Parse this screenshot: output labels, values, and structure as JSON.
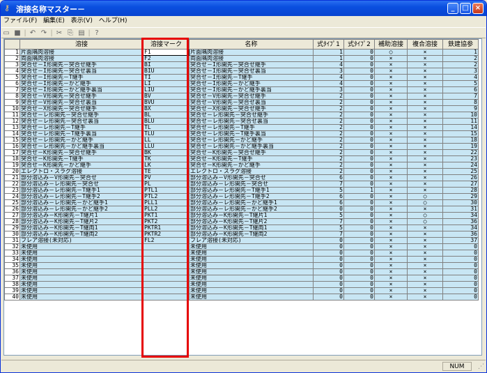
{
  "window": {
    "title": "溶接名称マスター－",
    "app_icon": "key-icon"
  },
  "menu": [
    "ファイル(F)",
    "編集(E)",
    "表示(V)",
    "ヘルプ(H)"
  ],
  "toolbar_icons": [
    "new-icon",
    "save-icon",
    "undo-icon",
    "redo-icon",
    "cut-icon",
    "copy-icon",
    "paste-icon",
    "help-icon"
  ],
  "toolbar_glyphs": [
    "▭",
    "■",
    "↶",
    "↷",
    "✂",
    "⎘",
    "▤",
    "?"
  ],
  "columns": [
    "",
    "溶接",
    "溶接マーク",
    "名称",
    "式ﾀｲﾌﾟ1",
    "式ﾀｲﾌﾟ2",
    "補助溶接",
    "複合溶接",
    "鉄建協参"
  ],
  "rows": [
    [
      "1",
      "片面隅肉溶接",
      "F1",
      "片面隅肉溶接",
      "1",
      "0",
      "○",
      "×",
      "1"
    ],
    [
      "2",
      "両面隅肉溶接",
      "F2",
      "両面隅肉溶接",
      "1",
      "0",
      "×",
      "×",
      "2"
    ],
    [
      "3",
      "突合せ－I形開先－突合せ継手",
      "BI",
      "突合せ－I形開先－突合せ継手",
      "4",
      "0",
      "×",
      "×",
      "2"
    ],
    [
      "4",
      "突合せ－I形開先－突合せ裏当",
      "BIU",
      "突合せ－I形開先－突合せ裏当",
      "3",
      "0",
      "×",
      "×",
      "3"
    ],
    [
      "5",
      "突合せ－I形開先－T継手",
      "TI",
      "突合せ－I形開先－T継手",
      "4",
      "0",
      "×",
      "×",
      "4"
    ],
    [
      "6",
      "突合せ－I形開先－かど継手",
      "LI",
      "突合せ－I形開先－かど継手",
      "4",
      "0",
      "×",
      "×",
      "5"
    ],
    [
      "7",
      "突合せ－I形開先－かど継手裏当",
      "LIU",
      "突合せ－I形開先－かど継手裏当",
      "3",
      "0",
      "×",
      "×",
      "6"
    ],
    [
      "8",
      "突合せ－V形開先－突合せ継手",
      "BV",
      "突合せ－V形開先－突合せ継手",
      "2",
      "0",
      "×",
      "×",
      "7"
    ],
    [
      "9",
      "突合せ－V形開先－突合せ裏当",
      "BVU",
      "突合せ－V形開先－突合せ裏当",
      "2",
      "0",
      "×",
      "×",
      "8"
    ],
    [
      "10",
      "突合せ－X形開先－突合せ継手",
      "BX",
      "突合せ－X形開先－突合せ継手",
      "2",
      "0",
      "×",
      "×",
      "9"
    ],
    [
      "11",
      "突合せ－レ形開先－突合せ継手",
      "BL",
      "突合せ－レ形開先－突合せ継手",
      "2",
      "0",
      "×",
      "×",
      "10"
    ],
    [
      "12",
      "突合せ－レ形開先－突合せ裏当",
      "BLU",
      "突合せ－レ形開先－突合せ裏当",
      "2",
      "0",
      "×",
      "×",
      "11"
    ],
    [
      "13",
      "突合せ－レ形開先－T継手",
      "TL",
      "突合せ－レ形開先－T継手",
      "2",
      "0",
      "×",
      "×",
      "14"
    ],
    [
      "14",
      "突合せ－レ形開先－T継手裏当",
      "TLU",
      "突合せ－レ形開先－T継手裏当",
      "2",
      "0",
      "×",
      "×",
      "15"
    ],
    [
      "15",
      "突合せ－レ形開先－かど継手",
      "LL",
      "突合せ－レ形開先－かど継手",
      "2",
      "0",
      "×",
      "×",
      "18"
    ],
    [
      "16",
      "突合せ－レ形開先－かど継手裏当",
      "LLU",
      "突合せ－レ形開先－かど継手裏当",
      "2",
      "0",
      "×",
      "×",
      "19"
    ],
    [
      "17",
      "突合せ－K形開先－突合せ継手",
      "BK",
      "突合せ－K形開先－突合せ継手",
      "2",
      "0",
      "×",
      "×",
      "22"
    ],
    [
      "18",
      "突合せ－K形開先－T継手",
      "TK",
      "突合せ－K形開先－T継手",
      "2",
      "0",
      "×",
      "×",
      "23"
    ],
    [
      "19",
      "突合せ－K形開先－かど継手",
      "LK",
      "突合せ－K形開先－かど継手",
      "2",
      "0",
      "×",
      "×",
      "24"
    ],
    [
      "20",
      "エレクトロ・スラグ溶接",
      "TE",
      "エレクトロ・スラグ溶接",
      "2",
      "0",
      "×",
      "×",
      "25"
    ],
    [
      "21",
      "部分溶込み－V形開先－突合せ",
      "PV",
      "部分溶込み－V形開先－突合せ",
      "6",
      "0",
      "×",
      "×",
      "26"
    ],
    [
      "22",
      "部分溶込み－レ形開先－突合せ",
      "PL",
      "部分溶込み－レ形開先－突合せ",
      "7",
      "0",
      "×",
      "×",
      "27"
    ],
    [
      "23",
      "部分溶込み－レ形開先－T継手1",
      "PTL1",
      "部分溶込み－レ形開先－T継手1",
      "5",
      "1",
      "×",
      "×",
      "28"
    ],
    [
      "24",
      "部分溶込み－レ形開先－T継手2",
      "PTL2",
      "部分溶込み－レ形開先－T継手2",
      "6",
      "0",
      "×",
      "○",
      "29"
    ],
    [
      "25",
      "部分溶込み－レ形開先－かど継手1",
      "PLL1",
      "部分溶込み－レ形開先－かど継手1",
      "6",
      "0",
      "×",
      "○",
      "30"
    ],
    [
      "26",
      "部分溶込み－レ形開先－かど継手2",
      "PLL2",
      "部分溶込み－レ形開先－かど継手2",
      "0",
      "0",
      "×",
      "×",
      "31"
    ],
    [
      "27",
      "部分溶込み－K形開先－T継片1",
      "PKT1",
      "部分溶込み－K形開先－T継片1",
      "5",
      "0",
      "×",
      "○",
      "34"
    ],
    [
      "28",
      "部分溶込み－K形開先－T継片2",
      "PKT2",
      "部分溶込み－K形開先－T継片2",
      "7",
      "0",
      "×",
      "○",
      "36"
    ],
    [
      "29",
      "部分溶込み－K形開先－T継両1",
      "PKTR1",
      "部分溶込み－K形開先－T継両1",
      "5",
      "0",
      "×",
      "×",
      "34"
    ],
    [
      "30",
      "部分溶込み－K形開先－T継両2",
      "PKTR2",
      "部分溶込み－K形開先－T継両2",
      "7",
      "0",
      "×",
      "×",
      "36"
    ],
    [
      "31",
      "フレア溶接(未対応)",
      "FL2",
      "フレア溶接(未対応)",
      "0",
      "0",
      "×",
      "×",
      "37"
    ],
    [
      "32",
      "未使用",
      "",
      "未使用",
      "0",
      "0",
      "×",
      "×",
      "0"
    ],
    [
      "33",
      "未使用",
      "",
      "未使用",
      "0",
      "0",
      "×",
      "×",
      "0"
    ],
    [
      "34",
      "未使用",
      "",
      "未使用",
      "0",
      "0",
      "×",
      "×",
      "0"
    ],
    [
      "35",
      "未使用",
      "",
      "未使用",
      "0",
      "0",
      "×",
      "×",
      "0"
    ],
    [
      "36",
      "未使用",
      "",
      "未使用",
      "0",
      "0",
      "×",
      "×",
      "0"
    ],
    [
      "37",
      "未使用",
      "",
      "未使用",
      "0",
      "0",
      "×",
      "×",
      "0"
    ],
    [
      "38",
      "未使用",
      "",
      "未使用",
      "0",
      "0",
      "×",
      "×",
      "0"
    ],
    [
      "39",
      "未使用",
      "",
      "未使用",
      "0",
      "0",
      "×",
      "×",
      "0"
    ],
    [
      "40",
      "未使用",
      "",
      "未使用",
      "0",
      "0",
      "×",
      "×",
      "0"
    ]
  ],
  "status": {
    "num": "NUM"
  },
  "colors": {
    "cell_bg": "#c8e6f4",
    "highlight_border": "#e60000"
  }
}
